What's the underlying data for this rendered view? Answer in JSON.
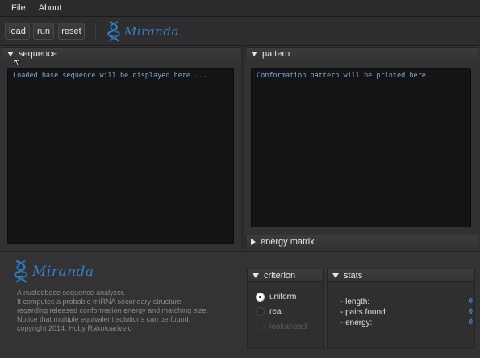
{
  "menubar": {
    "items": [
      "File",
      "About"
    ]
  },
  "toolbar": {
    "load_label": "load",
    "run_label": "run",
    "reset_label": "reset"
  },
  "brand": {
    "name": "Miranda",
    "accent": "#3a7fc4"
  },
  "sequence_panel": {
    "title": "sequence",
    "text": "Loaded base sequence will be displayed here ..."
  },
  "pattern_panel": {
    "title": "pattern",
    "text": "Conformation pattern will be printed here ..."
  },
  "energy_panel": {
    "title": "energy matrix",
    "collapsed": true
  },
  "about": {
    "lines": [
      "A nucleobase sequence analyzer.",
      "It computes a probable miRNA secondary structure",
      "regarding released conformation energy and matching size.",
      "Notice that multiple equivalent solutions can be found.",
      "copyright 2014, Hoby Rakotoarivelo"
    ]
  },
  "criterion": {
    "title": "criterion",
    "options": [
      {
        "label": "uniform",
        "state": "selected"
      },
      {
        "label": "real",
        "state": "unselected"
      },
      {
        "label": "lookahead",
        "state": "disabled"
      }
    ]
  },
  "stats": {
    "title": "stats",
    "rows": [
      {
        "label": "- length:",
        "value": "0"
      },
      {
        "label": "- pairs found:",
        "value": "0"
      },
      {
        "label": "- energy:",
        "value": "0"
      }
    ]
  }
}
